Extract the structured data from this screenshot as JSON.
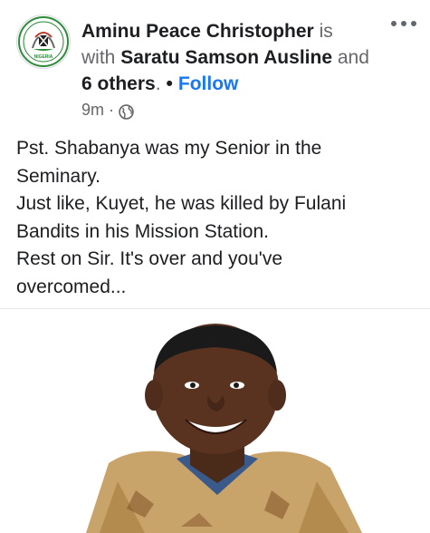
{
  "post": {
    "author": "Aminu Peace Christopher",
    "is_with": "is with",
    "tagged": "Saratu Samson Ausline",
    "and_label": "and",
    "others": "6 others",
    "period": ".",
    "follow_label": "Follow",
    "time": "9m",
    "separator": "·",
    "privacy_icon": "globe-icon",
    "more_icon": "more-options-icon",
    "avatar_logo_text": "NIGERIA",
    "lines": [
      "Pst. Shabanya was my Senior in the",
      "Seminary.",
      "Just like, Kuyet, he was killed by Fulani",
      "Bandits in his Mission Station.",
      "Rest on Sir. It's over and you've",
      "overcomed..."
    ]
  },
  "colors": {
    "link": "#1877f2",
    "secondary_text": "#65676b",
    "primary_text": "#1c1e21"
  }
}
